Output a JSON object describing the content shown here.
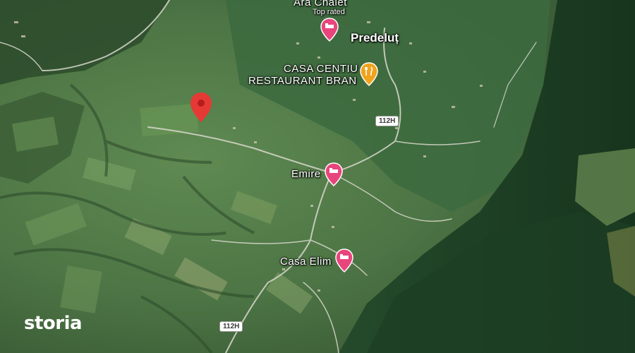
{
  "places": {
    "ara_chalet": "Ara Chalet",
    "ara_chalet_sub": "Top rated",
    "predelut": "Predeluț",
    "casa_centiu_1": "CASA CENTIU",
    "casa_centiu_2": "RESTAURANT BRAN",
    "emire": "Emire",
    "casa_elim": "Casa Elim"
  },
  "roads": {
    "r1": "112H",
    "r2": "112H"
  },
  "branding": {
    "logo": "storia"
  },
  "icons": {
    "hotel": "bed-icon",
    "restaurant": "fork-knife-icon",
    "pin": "location-pin-icon"
  },
  "colors": {
    "poi_pink": "#e8457d",
    "restaurant_amber": "#f0a31c",
    "pin_red": "#e53935"
  }
}
